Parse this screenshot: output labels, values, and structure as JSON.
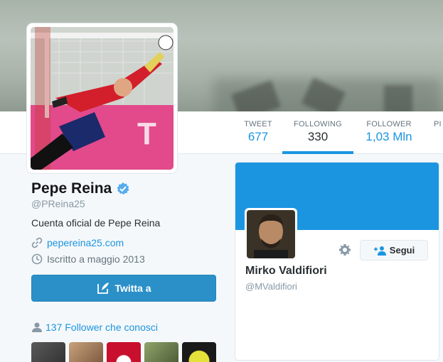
{
  "stats": {
    "tweet": {
      "label": "TWEET",
      "value": "677"
    },
    "following": {
      "label": "FOLLOWING",
      "value": "330"
    },
    "follower": {
      "label": "FOLLOWER",
      "value": "1,03 Mln"
    },
    "more": {
      "label": "PI"
    }
  },
  "profile": {
    "name": "Pepe Reina",
    "handle": "@PReina25",
    "bio": "Cuenta oficial de Pepe Reina",
    "url": "pepereina25.com",
    "joined": "Iscritto a maggio 2013",
    "tweet_button": "Twitta a",
    "followers_you_know": "137 Follower che conosci"
  },
  "follow_card": {
    "name": "Mirko Valdifiori",
    "handle": "@MValdifiori",
    "follow_label": "Segui"
  },
  "colors": {
    "accent": "#1b95e0",
    "tweet_button": "#2b90c8"
  },
  "icons": [
    "verified-badge-icon",
    "link-icon",
    "clock-icon",
    "compose-icon",
    "person-icon",
    "gear-icon",
    "add-person-icon"
  ]
}
